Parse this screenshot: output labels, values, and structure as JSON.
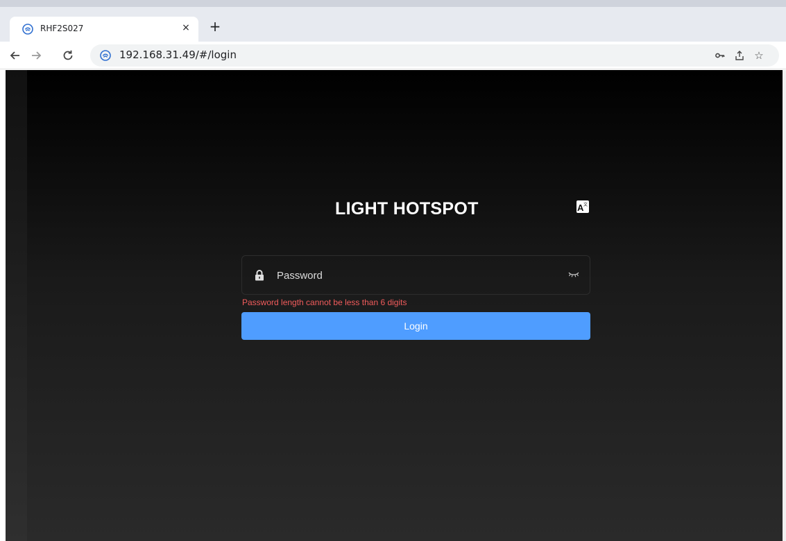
{
  "browser": {
    "tab": {
      "title": "RHF2S027",
      "close_glyph": "×"
    },
    "new_tab_glyph": "+",
    "url": "192.168.31.49/#/login",
    "icons": {
      "back": "back-arrow-icon",
      "forward": "forward-arrow-icon",
      "reload": "reload-icon",
      "favicon": "site-favicon-icon",
      "key": "key-icon",
      "share": "share-icon",
      "star": "bookmark-star-icon"
    },
    "star_glyph": "☆"
  },
  "login": {
    "title": "LIGHT HOTSPOT",
    "language_icon": "translate-icon",
    "password_placeholder": "Password",
    "password_value": "",
    "error_message": "Password length cannot be less than 6 digits",
    "button_label": "Login"
  },
  "colors": {
    "accent": "#4f9dff",
    "error": "#f25c5c",
    "page_background": "#111111"
  }
}
